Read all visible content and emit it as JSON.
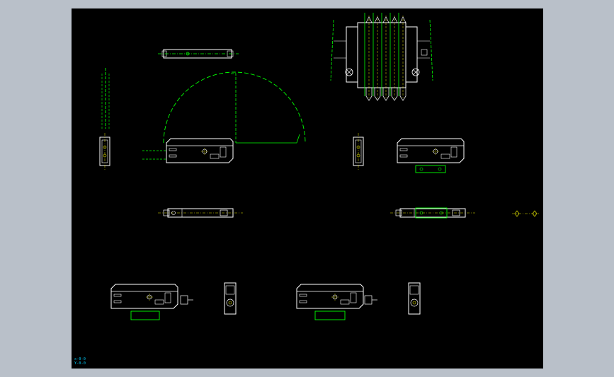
{
  "app": {
    "view": "cad-model-space"
  },
  "colors": {
    "background": "#b9c0c9",
    "canvas": "#000000",
    "outline": "#ffffff",
    "construction": "#00ff00",
    "centerline": "#e0e000",
    "coordinate_text": "#00d0ff"
  },
  "drawing": {
    "coordinate_readout": [
      "x-0-0",
      "Y-0-0"
    ],
    "views": [
      "sensor-top-view-upper",
      "fiber-bundle-view",
      "sensor-side-view-left",
      "sensor-front-view-left",
      "sensor-front-view-right",
      "sensor-end-view-right",
      "sensor-top-view-left",
      "sensor-top-view-right",
      "sensor-bottom-front-view-left",
      "sensor-bottom-end-view-left",
      "sensor-bottom-front-view-right",
      "sensor-bottom-end-view-right"
    ]
  }
}
